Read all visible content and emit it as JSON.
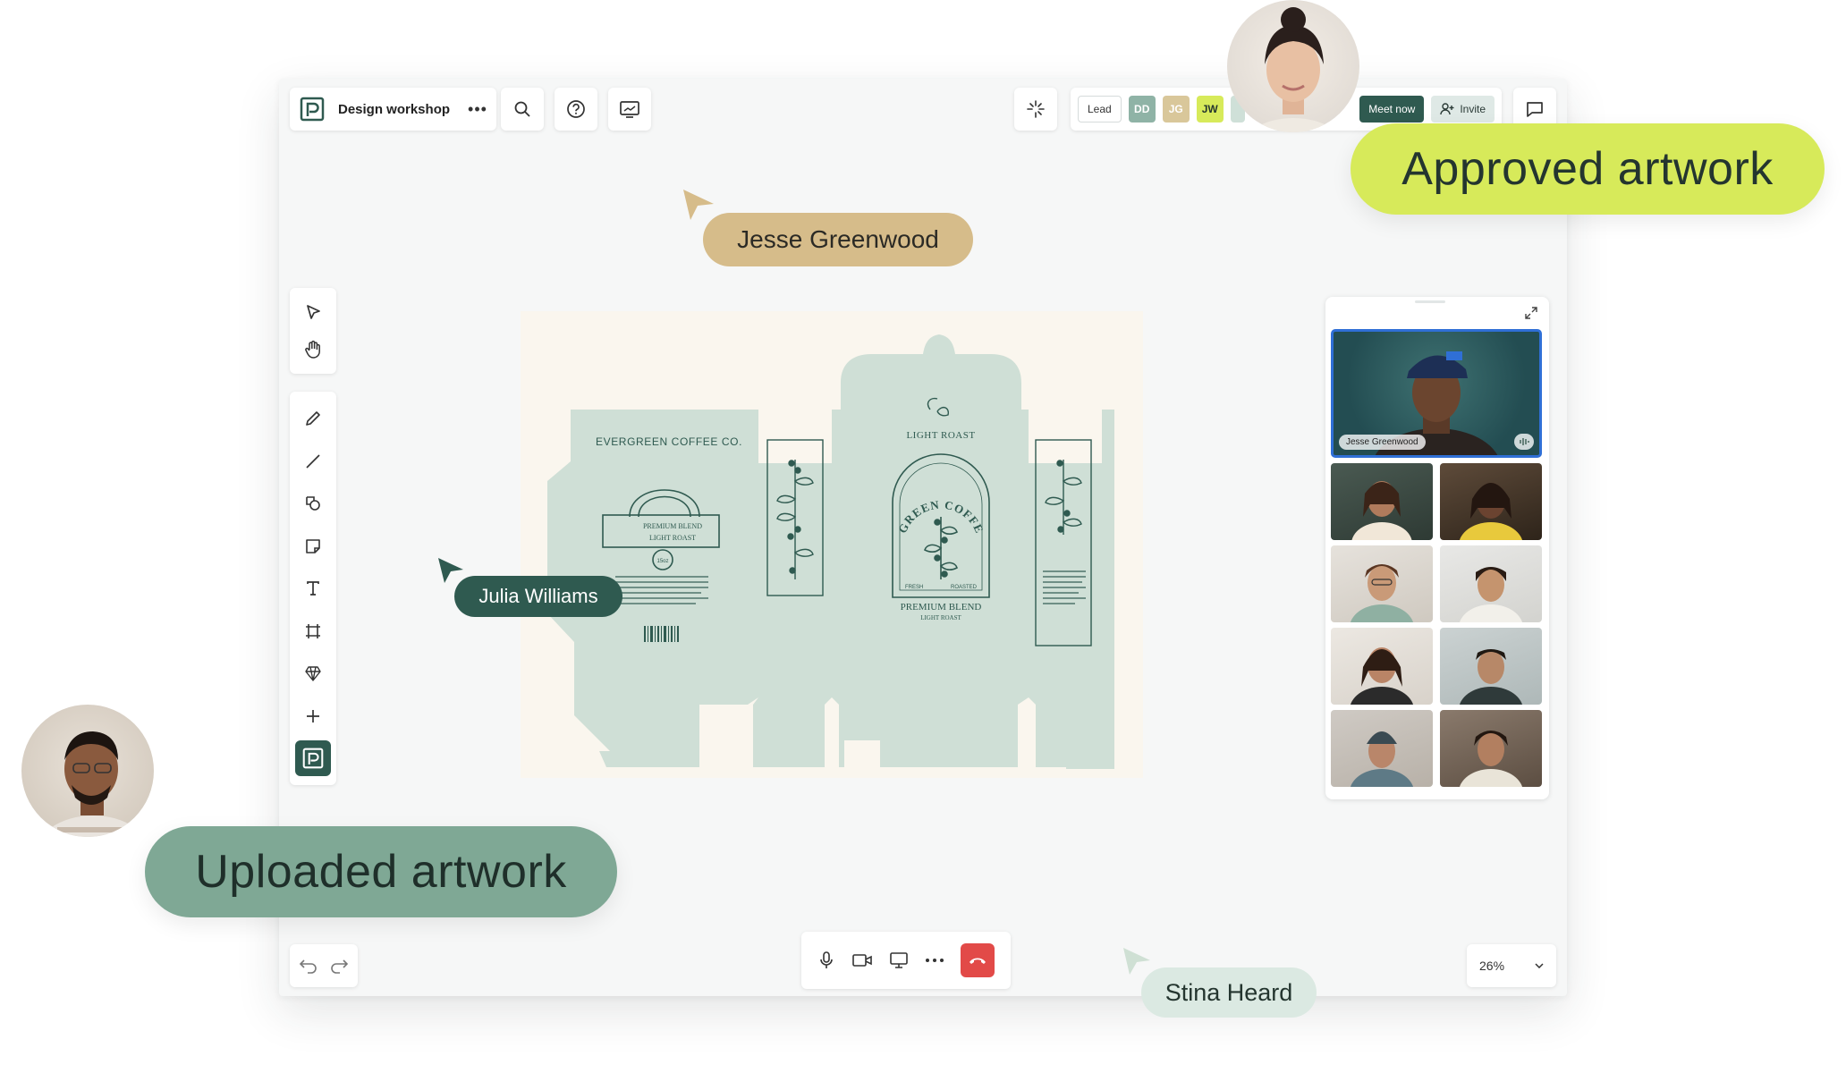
{
  "toolbar": {
    "title": "Design workshop",
    "more": "•••",
    "lead": "Lead",
    "initials": [
      {
        "text": "DD",
        "bg": "#8fb3a6",
        "fg": "#ffffff"
      },
      {
        "text": "JG",
        "bg": "#d9c79a",
        "fg": "#ffffff"
      },
      {
        "text": "JW",
        "bg": "#d7ea5a",
        "fg": "#24352f"
      }
    ],
    "meet_now": "Meet now",
    "invite": "Invite"
  },
  "zoom": {
    "value": "26%"
  },
  "artwork": {
    "brand": "EVERGREEN COFFEE CO.",
    "roast": "LIGHT ROAST",
    "badge_line1": "PREMIUM BLEND",
    "badge_line2": "LIGHT ROAST",
    "badge_size": "15oz",
    "arch_text": "EVERGREEN COFFEE CO.",
    "fresh": "FRESH",
    "roasted": "ROASTED",
    "panel_line1": "PREMIUM BLEND",
    "panel_line2": "LIGHT ROAST"
  },
  "video": {
    "speaker_name": "Jesse Greenwood"
  },
  "cursors": {
    "jesse": "Jesse Greenwood",
    "julia": "Julia Williams",
    "stina": "Stina Heard"
  },
  "callouts": {
    "approved": "Approved artwork",
    "uploaded": "Uploaded artwork"
  },
  "colors": {
    "brand_green": "#2f5a50",
    "box_green": "#cfdfd6",
    "ink": "#2f5a50",
    "lime": "#d7ea5a",
    "sage": "#7fa895",
    "tan": "#d6bc8a",
    "mint": "#dbe9e2",
    "hangup": "#e24a48"
  }
}
